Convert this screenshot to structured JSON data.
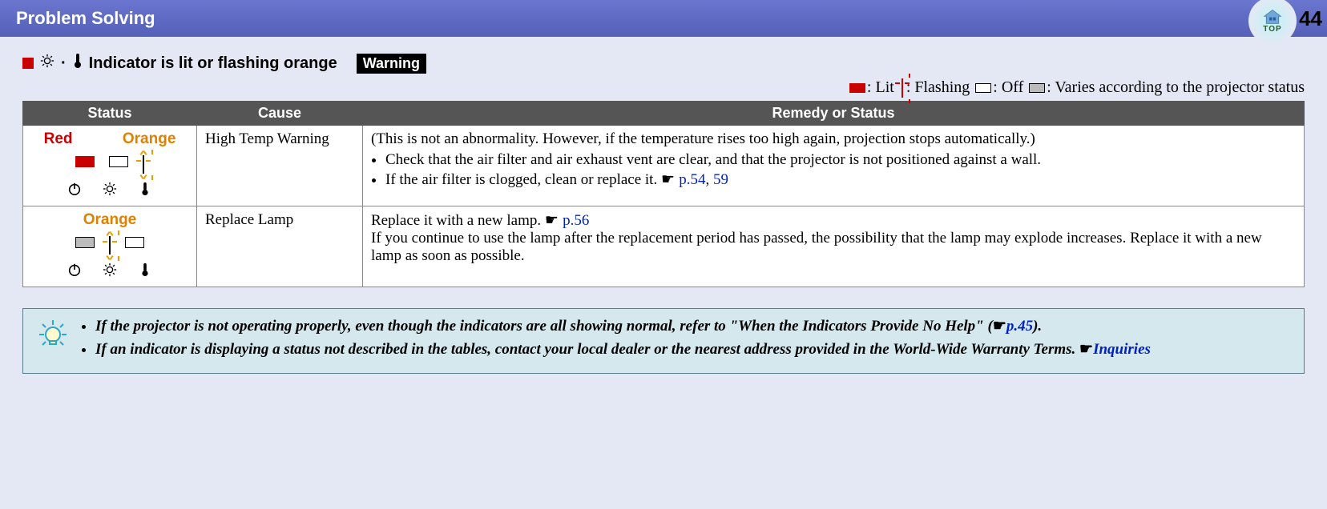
{
  "header": {
    "title": "Problem Solving",
    "page_number": "44",
    "top_label": "TOP"
  },
  "section": {
    "heading": "Indicator is lit or flashing orange",
    "warning_label": "Warning"
  },
  "legend": {
    "lit": ": Lit ",
    "flashing": ": Flashing ",
    "off": ": Off ",
    "varies": ": Varies according to the projector status"
  },
  "table": {
    "headers": [
      "Status",
      "Cause",
      "Remedy or Status"
    ],
    "rows": [
      {
        "status_labels": [
          {
            "text": "Red",
            "cls": "color-red"
          },
          {
            "text": "Orange",
            "cls": "color-orange"
          }
        ],
        "indicators": [
          "lit-red",
          "off",
          "flash-orange"
        ],
        "cause": "High Temp Warning",
        "remedy_intro": "(This is not an abnormality. However, if the temperature rises too high again, projection stops automatically.)",
        "remedy_items": [
          "Check that the air filter and air exhaust vent are clear, and that the projector is not positioned against a wall.",
          "If the air filter is clogged, clean or replace it. "
        ],
        "remedy_links": [
          {
            "prefix": "☛ ",
            "text": "p.54",
            "after": ", "
          },
          {
            "prefix": "",
            "text": "59",
            "after": ""
          }
        ]
      },
      {
        "status_labels": [
          {
            "text": "Orange",
            "cls": "color-orange"
          }
        ],
        "indicators": [
          "varies",
          "flash-orange",
          "off"
        ],
        "cause": "Replace Lamp",
        "remedy_intro": "Replace it with a new lamp. ",
        "remedy_intro_link": {
          "prefix": "☛ ",
          "text": "p.56"
        },
        "remedy_tail": "If you continue to use the lamp after the replacement period has passed, the possibility that the lamp may explode increases. Replace it with a new lamp as soon as possible."
      }
    ]
  },
  "tip": {
    "items": [
      {
        "text_a": "If the projector is not operating properly, even though the indicators are all showing normal, refer to \"When the Indicators Provide No Help\" (",
        "pointer": "☛",
        "link": "p.45",
        "text_b": ")."
      },
      {
        "text_a": "If an indicator is displaying a status not described in the tables, contact your local dealer or the nearest address provided in the World-Wide Warranty Terms. ",
        "pointer": "☛",
        "link": "Inquiries",
        "text_b": ""
      }
    ]
  }
}
